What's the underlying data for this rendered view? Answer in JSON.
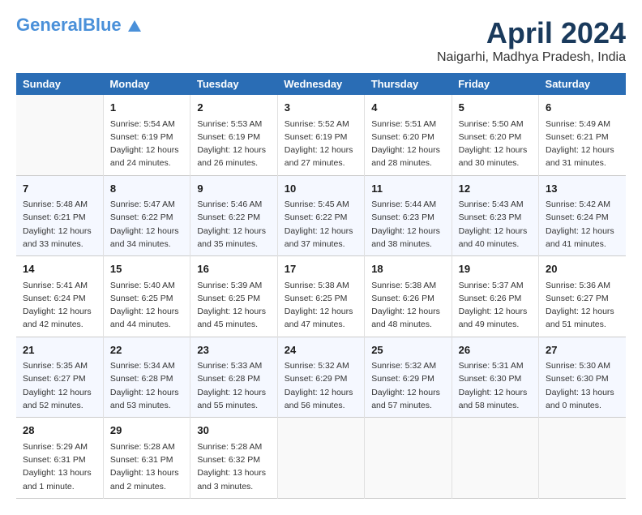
{
  "header": {
    "logo_general": "General",
    "logo_blue": "Blue",
    "month": "April 2024",
    "location": "Naigarhi, Madhya Pradesh, India"
  },
  "weekdays": [
    "Sunday",
    "Monday",
    "Tuesday",
    "Wednesday",
    "Thursday",
    "Friday",
    "Saturday"
  ],
  "weeks": [
    [
      {
        "day": "",
        "info": ""
      },
      {
        "day": "1",
        "info": "Sunrise: 5:54 AM\nSunset: 6:19 PM\nDaylight: 12 hours\nand 24 minutes."
      },
      {
        "day": "2",
        "info": "Sunrise: 5:53 AM\nSunset: 6:19 PM\nDaylight: 12 hours\nand 26 minutes."
      },
      {
        "day": "3",
        "info": "Sunrise: 5:52 AM\nSunset: 6:19 PM\nDaylight: 12 hours\nand 27 minutes."
      },
      {
        "day": "4",
        "info": "Sunrise: 5:51 AM\nSunset: 6:20 PM\nDaylight: 12 hours\nand 28 minutes."
      },
      {
        "day": "5",
        "info": "Sunrise: 5:50 AM\nSunset: 6:20 PM\nDaylight: 12 hours\nand 30 minutes."
      },
      {
        "day": "6",
        "info": "Sunrise: 5:49 AM\nSunset: 6:21 PM\nDaylight: 12 hours\nand 31 minutes."
      }
    ],
    [
      {
        "day": "7",
        "info": "Sunrise: 5:48 AM\nSunset: 6:21 PM\nDaylight: 12 hours\nand 33 minutes."
      },
      {
        "day": "8",
        "info": "Sunrise: 5:47 AM\nSunset: 6:22 PM\nDaylight: 12 hours\nand 34 minutes."
      },
      {
        "day": "9",
        "info": "Sunrise: 5:46 AM\nSunset: 6:22 PM\nDaylight: 12 hours\nand 35 minutes."
      },
      {
        "day": "10",
        "info": "Sunrise: 5:45 AM\nSunset: 6:22 PM\nDaylight: 12 hours\nand 37 minutes."
      },
      {
        "day": "11",
        "info": "Sunrise: 5:44 AM\nSunset: 6:23 PM\nDaylight: 12 hours\nand 38 minutes."
      },
      {
        "day": "12",
        "info": "Sunrise: 5:43 AM\nSunset: 6:23 PM\nDaylight: 12 hours\nand 40 minutes."
      },
      {
        "day": "13",
        "info": "Sunrise: 5:42 AM\nSunset: 6:24 PM\nDaylight: 12 hours\nand 41 minutes."
      }
    ],
    [
      {
        "day": "14",
        "info": "Sunrise: 5:41 AM\nSunset: 6:24 PM\nDaylight: 12 hours\nand 42 minutes."
      },
      {
        "day": "15",
        "info": "Sunrise: 5:40 AM\nSunset: 6:25 PM\nDaylight: 12 hours\nand 44 minutes."
      },
      {
        "day": "16",
        "info": "Sunrise: 5:39 AM\nSunset: 6:25 PM\nDaylight: 12 hours\nand 45 minutes."
      },
      {
        "day": "17",
        "info": "Sunrise: 5:38 AM\nSunset: 6:25 PM\nDaylight: 12 hours\nand 47 minutes."
      },
      {
        "day": "18",
        "info": "Sunrise: 5:38 AM\nSunset: 6:26 PM\nDaylight: 12 hours\nand 48 minutes."
      },
      {
        "day": "19",
        "info": "Sunrise: 5:37 AM\nSunset: 6:26 PM\nDaylight: 12 hours\nand 49 minutes."
      },
      {
        "day": "20",
        "info": "Sunrise: 5:36 AM\nSunset: 6:27 PM\nDaylight: 12 hours\nand 51 minutes."
      }
    ],
    [
      {
        "day": "21",
        "info": "Sunrise: 5:35 AM\nSunset: 6:27 PM\nDaylight: 12 hours\nand 52 minutes."
      },
      {
        "day": "22",
        "info": "Sunrise: 5:34 AM\nSunset: 6:28 PM\nDaylight: 12 hours\nand 53 minutes."
      },
      {
        "day": "23",
        "info": "Sunrise: 5:33 AM\nSunset: 6:28 PM\nDaylight: 12 hours\nand 55 minutes."
      },
      {
        "day": "24",
        "info": "Sunrise: 5:32 AM\nSunset: 6:29 PM\nDaylight: 12 hours\nand 56 minutes."
      },
      {
        "day": "25",
        "info": "Sunrise: 5:32 AM\nSunset: 6:29 PM\nDaylight: 12 hours\nand 57 minutes."
      },
      {
        "day": "26",
        "info": "Sunrise: 5:31 AM\nSunset: 6:30 PM\nDaylight: 12 hours\nand 58 minutes."
      },
      {
        "day": "27",
        "info": "Sunrise: 5:30 AM\nSunset: 6:30 PM\nDaylight: 13 hours\nand 0 minutes."
      }
    ],
    [
      {
        "day": "28",
        "info": "Sunrise: 5:29 AM\nSunset: 6:31 PM\nDaylight: 13 hours\nand 1 minute."
      },
      {
        "day": "29",
        "info": "Sunrise: 5:28 AM\nSunset: 6:31 PM\nDaylight: 13 hours\nand 2 minutes."
      },
      {
        "day": "30",
        "info": "Sunrise: 5:28 AM\nSunset: 6:32 PM\nDaylight: 13 hours\nand 3 minutes."
      },
      {
        "day": "",
        "info": ""
      },
      {
        "day": "",
        "info": ""
      },
      {
        "day": "",
        "info": ""
      },
      {
        "day": "",
        "info": ""
      }
    ]
  ]
}
